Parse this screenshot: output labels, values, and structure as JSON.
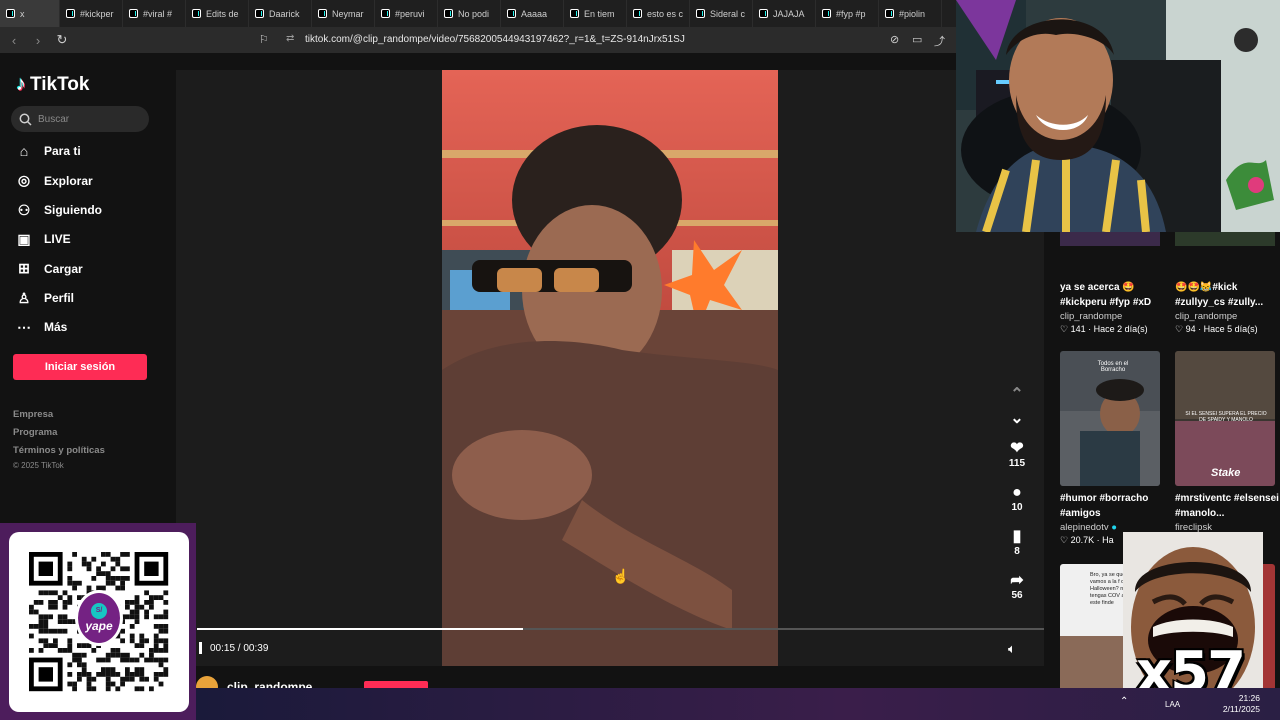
{
  "browser": {
    "tabs": [
      {
        "label": "x"
      },
      {
        "label": "#kickper"
      },
      {
        "label": "#viral #"
      },
      {
        "label": "Edits de"
      },
      {
        "label": "Daarick"
      },
      {
        "label": "Neymar"
      },
      {
        "label": "#peruvi"
      },
      {
        "label": "No podi"
      },
      {
        "label": "Aaaaa"
      },
      {
        "label": "En tiem"
      },
      {
        "label": "esto es c"
      },
      {
        "label": "Sideral c"
      },
      {
        "label": "JAJAJA"
      },
      {
        "label": "#fyp #p"
      },
      {
        "label": "#piolin"
      }
    ],
    "url": "tiktok.com/@clip_randompe/video/7568200544943197462?_r=1&_t=ZS-914nJrx51SJ"
  },
  "sidebar": {
    "logo_text": "TikTok",
    "search_placeholder": "Buscar",
    "nav": [
      {
        "label": "Para ti",
        "icon": "home-icon"
      },
      {
        "label": "Explorar",
        "icon": "compass-icon"
      },
      {
        "label": "Siguiendo",
        "icon": "following-icon"
      },
      {
        "label": "LIVE",
        "icon": "live-icon"
      },
      {
        "label": "Cargar",
        "icon": "upload-icon"
      },
      {
        "label": "Perfil",
        "icon": "profile-icon"
      },
      {
        "label": "Más",
        "icon": "more-icon"
      }
    ],
    "login_label": "Iniciar sesión",
    "footer": [
      "Empresa",
      "Programa",
      "Términos y políticas"
    ],
    "copyright": "© 2025 TikTok"
  },
  "video": {
    "actions": {
      "likes": "115",
      "comments": "10",
      "saves": "8",
      "shares": "56"
    },
    "time": "00:15 / 00:39",
    "progress": 0.3846,
    "author": "clip_randompe"
  },
  "recommendations": [
    {
      "title": "ya se acerca 🤩 #kickperu #fyp #xD",
      "author": "clip_randompe",
      "likes": "141",
      "age": "Hace 2 día(s)"
    },
    {
      "title": "🤩🤩😹#kick #zullyy_cs #zully...",
      "author": "clip_randompe",
      "likes": "94",
      "age": "Hace 5 día(s)"
    },
    {
      "title": "#humor #borracho #amigos",
      "author": "alepinedotv",
      "likes": "20.7K",
      "age": "Ha"
    },
    {
      "title": "#mrstiventc #elsensei #manolo...",
      "author": "fireclipsk",
      "likes": "",
      "age": ""
    }
  ],
  "thumb_texts": {
    "t1": "Todos en el Borracho",
    "t2": "SI EL SENSEI SUPERA EL PRECIO DE SPAIDY Y MANOLO",
    "t2_brand": "Stake",
    "t3": "Bro, ya se que 40 de hoy, vamos a la f de Halloween? no me recibes tengas COV aparte dicen este finde"
  },
  "overlays": {
    "yape_label": "yape",
    "meme_text": "x57"
  },
  "taskbar": {
    "lang": "LAA",
    "time": "21:26",
    "date": "2/11/2025"
  }
}
